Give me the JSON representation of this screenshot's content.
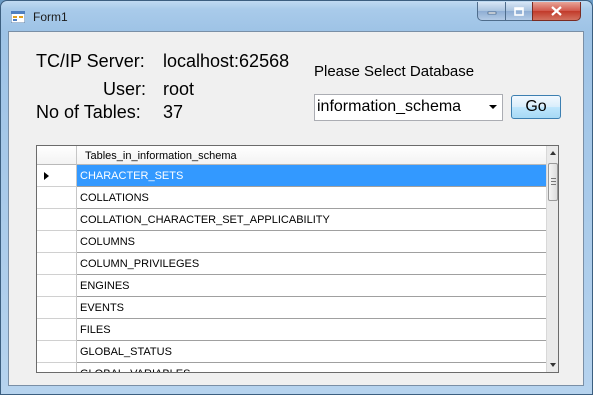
{
  "window": {
    "title": "Form1"
  },
  "server": {
    "label": "TC/IP Server:",
    "value": "localhost:62568"
  },
  "user": {
    "label": "User:",
    "value": "root"
  },
  "tables_count": {
    "label": "No of Tables:",
    "value": "37"
  },
  "database_select": {
    "prompt": "Please Select Database",
    "selected": "information_schema"
  },
  "go_button": {
    "label": "Go"
  },
  "grid": {
    "column_header": "Tables_in_information_schema",
    "selected_index": 0,
    "rows": [
      "CHARACTER_SETS",
      "COLLATIONS",
      "COLLATION_CHARACTER_SET_APPLICABILITY",
      "COLUMNS",
      "COLUMN_PRIVILEGES",
      "ENGINES",
      "EVENTS",
      "FILES",
      "GLOBAL_STATUS",
      "GLOBAL_VARIABLES"
    ]
  },
  "colors": {
    "selection": "#3399ff",
    "titlebar": "#a9cbea",
    "client": "#f0f0f0"
  }
}
